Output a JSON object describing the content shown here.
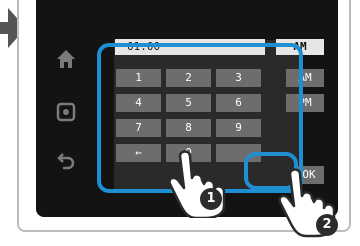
{
  "display": {
    "time": "01:00",
    "ampm": "AM"
  },
  "keypad": {
    "keys": [
      "1",
      "2",
      "3",
      "4",
      "5",
      "6",
      "7",
      "8",
      "9",
      "",
      "0",
      ""
    ],
    "backspace_glyph": "←",
    "am_label": "AM",
    "pm_label": "PM",
    "ok_label": "OK"
  },
  "side_icons": [
    "home-icon",
    "settings-icon",
    "back-icon"
  ],
  "callouts": {
    "step1": "1",
    "step2": "2"
  },
  "colors": {
    "screen": "#131313",
    "key": "#6d6d6d",
    "highlight": "#1f8fd2",
    "badge": "#2c2c2c"
  }
}
